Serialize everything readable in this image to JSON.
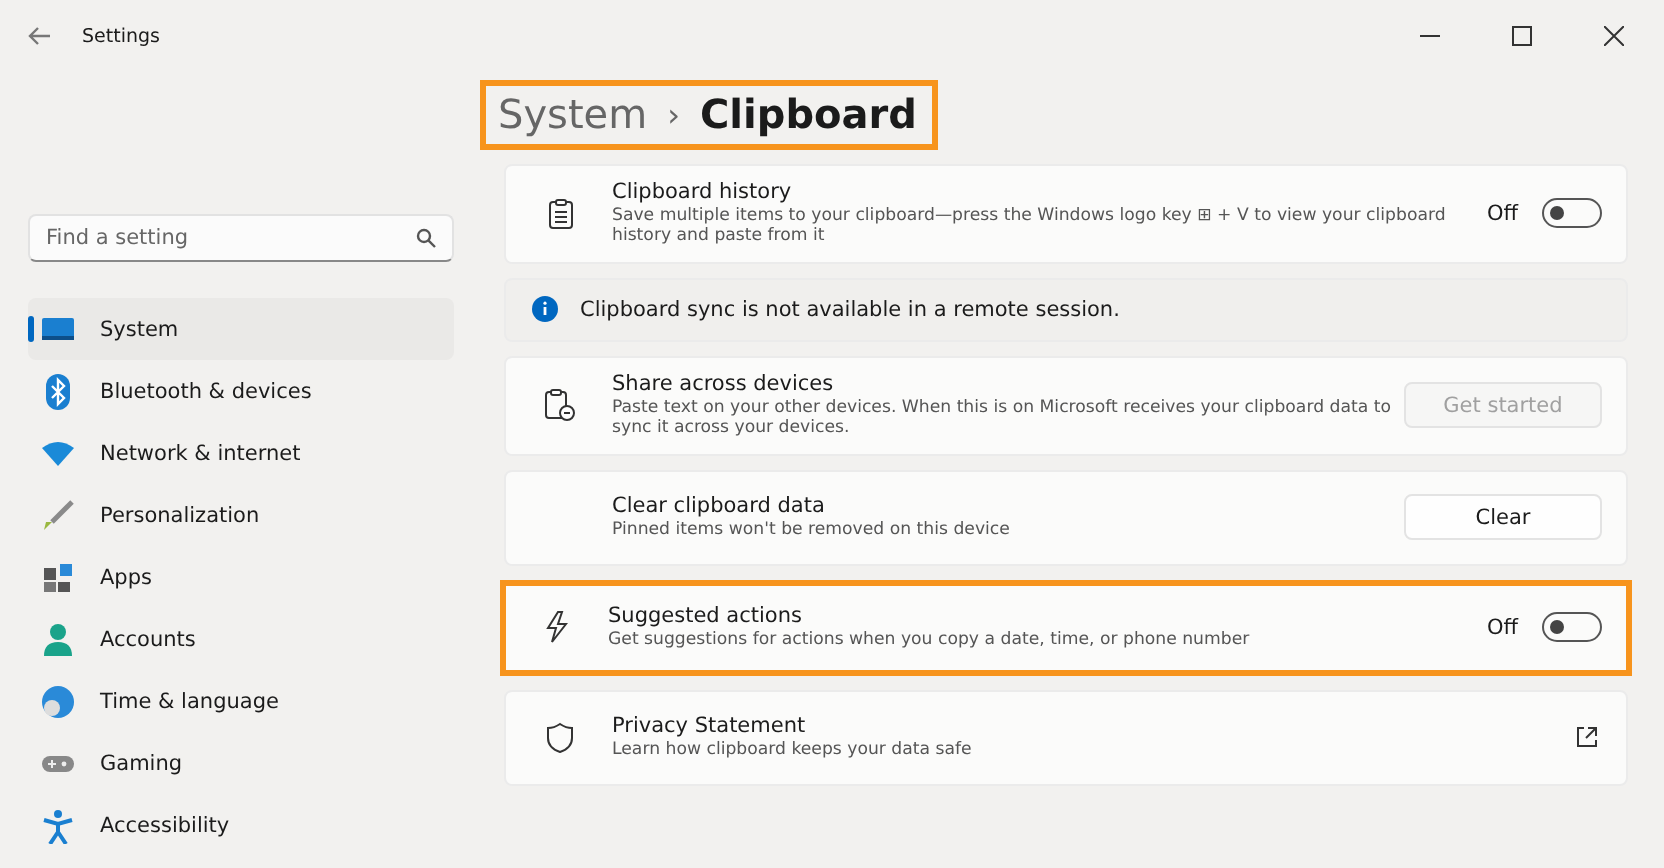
{
  "window": {
    "title": "Settings"
  },
  "breadcrumb": {
    "parent": "System",
    "separator": "›",
    "current": "Clipboard",
    "highlighted": true
  },
  "search": {
    "placeholder": "Find a setting"
  },
  "nav": [
    {
      "label": "System",
      "selected": true
    },
    {
      "label": "Bluetooth & devices",
      "selected": false
    },
    {
      "label": "Network & internet",
      "selected": false
    },
    {
      "label": "Personalization",
      "selected": false
    },
    {
      "label": "Apps",
      "selected": false
    },
    {
      "label": "Accounts",
      "selected": false
    },
    {
      "label": "Time & language",
      "selected": false
    },
    {
      "label": "Gaming",
      "selected": false
    },
    {
      "label": "Accessibility",
      "selected": false
    }
  ],
  "settings": [
    {
      "kind": "toggle",
      "title": "Clipboard history",
      "description": "Save multiple items to your clipboard—press the Windows logo key ⊞ + V to view your clipboard history and paste from it",
      "state_label": "Off",
      "on": false,
      "highlighted": false
    },
    {
      "kind": "info",
      "text": "Clipboard sync is not available in a remote session."
    },
    {
      "kind": "button",
      "title": "Share across devices",
      "description": "Paste text on your other devices. When this is on  Microsoft receives your clipboard data to sync it across your devices.",
      "button": "Get started",
      "disabled": true,
      "highlighted": false
    },
    {
      "kind": "button",
      "title": "Clear clipboard data",
      "description": "Pinned items won't be removed on this device",
      "button": "Clear",
      "disabled": false,
      "highlighted": false
    },
    {
      "kind": "toggle",
      "title": "Suggested actions",
      "description": "Get suggestions for actions when you copy a date, time, or phone number",
      "state_label": "Off",
      "on": false,
      "highlighted": true
    },
    {
      "kind": "link",
      "title": "Privacy Statement",
      "description": "Learn how clipboard keeps your data safe",
      "highlighted": false
    }
  ]
}
